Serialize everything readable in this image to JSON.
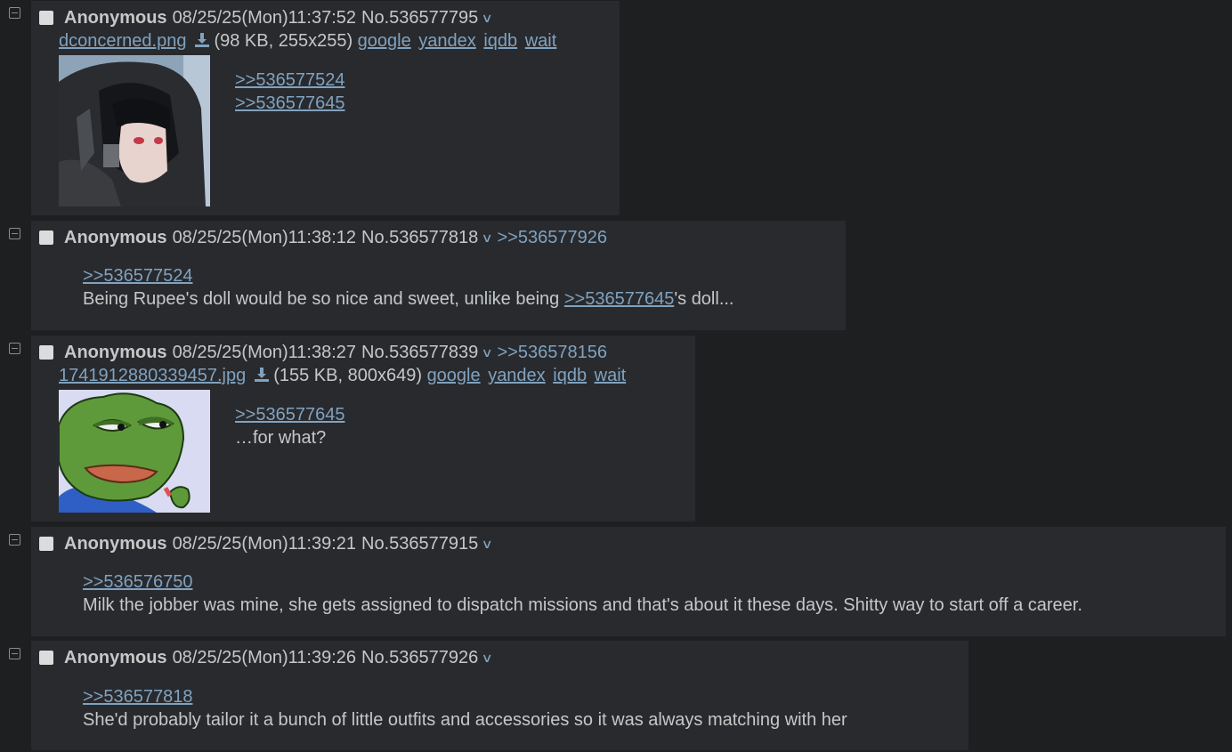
{
  "posts": [
    {
      "name": "Anonymous",
      "date": "08/25/25(Mon)11:37:52",
      "number": "No.536577795",
      "backlink": "",
      "file": {
        "filename": "dconcerned.png",
        "info": "(98 KB, 255x255)",
        "search": [
          "google",
          "yandex",
          "iqdb",
          "wait"
        ]
      },
      "quotes": [
        ">>536577524",
        ">>536577645"
      ],
      "text": ""
    },
    {
      "name": "Anonymous",
      "date": "08/25/25(Mon)11:38:12",
      "number": "No.536577818",
      "backlink": ">>536577926",
      "quotes": [
        ">>536577524"
      ],
      "text_before": "Being Rupee's doll would be so nice and sweet, unlike being ",
      "inline_quote": ">>536577645",
      "text_after": "'s doll..."
    },
    {
      "name": "Anonymous",
      "date": "08/25/25(Mon)11:38:27",
      "number": "No.536577839",
      "backlink": ">>536578156",
      "file": {
        "filename": "1741912880339457.jpg",
        "info": "(155 KB, 800x649)",
        "search": [
          "google",
          "yandex",
          "iqdb",
          "wait"
        ]
      },
      "quotes": [
        ">>536577645"
      ],
      "text": "…for what?"
    },
    {
      "name": "Anonymous",
      "date": "08/25/25(Mon)11:39:21",
      "number": "No.536577915",
      "backlink": "",
      "quotes": [
        ">>536576750"
      ],
      "text": "Milk the jobber was mine, she gets assigned to dispatch missions and that's about it these days. Shitty way to start off a career."
    },
    {
      "name": "Anonymous",
      "date": "08/25/25(Mon)11:39:26",
      "number": "No.536577926",
      "backlink": "",
      "quotes": [
        ">>536577818"
      ],
      "text": "She'd probably tailor it a bunch of little outfits and accessories so it was always matching with her"
    }
  ]
}
